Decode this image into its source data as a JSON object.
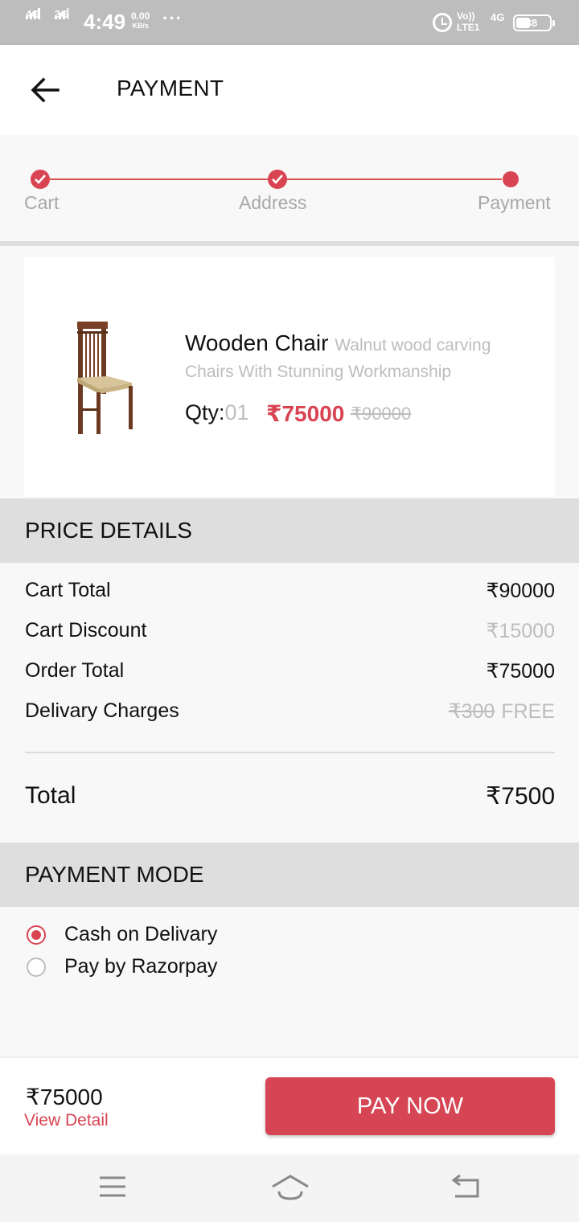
{
  "status_bar": {
    "net1": "4G",
    "net2": "3G",
    "time": "4:49",
    "speed_value": "0.00",
    "speed_unit": "KB/s",
    "more": "···",
    "volte_top": "Vo))",
    "volte_bottom": "LTE1",
    "net3": "4G",
    "battery": "38"
  },
  "header": {
    "title": "PAYMENT"
  },
  "stepper": {
    "steps": [
      "Cart",
      "Address",
      "Payment"
    ],
    "current_index": 2
  },
  "product": {
    "name": "Wooden Chair",
    "description": "Walnut wood carving Chairs With Stunning Workmanship",
    "qty_label": "Qty:",
    "qty_value": "01",
    "price": "₹75000",
    "original_price": "₹90000"
  },
  "price_details": {
    "heading": "PRICE DETAILS",
    "rows": [
      {
        "label": "Cart Total",
        "value": "₹90000"
      },
      {
        "label": "Cart Discount",
        "value": "₹15000"
      },
      {
        "label": "Order Total",
        "value": "₹75000"
      },
      {
        "label": "Delivary Charges",
        "value_strike": "₹300",
        "value": "FREE"
      }
    ],
    "total_label": "Total",
    "total_value": "₹7500"
  },
  "payment_mode": {
    "heading": "PAYMENT MODE",
    "options": [
      {
        "label": "Cash on Delivary",
        "selected": true
      },
      {
        "label": "Pay by Razorpay",
        "selected": false
      }
    ]
  },
  "bottom_bar": {
    "total": "₹75000",
    "view_detail": "View Detail",
    "pay_button": "PAY NOW"
  },
  "colors": {
    "accent": "#d94452",
    "muted_text": "#bdbdbd",
    "status_bar": "#bdbdbd",
    "section_bg": "#dedede"
  }
}
